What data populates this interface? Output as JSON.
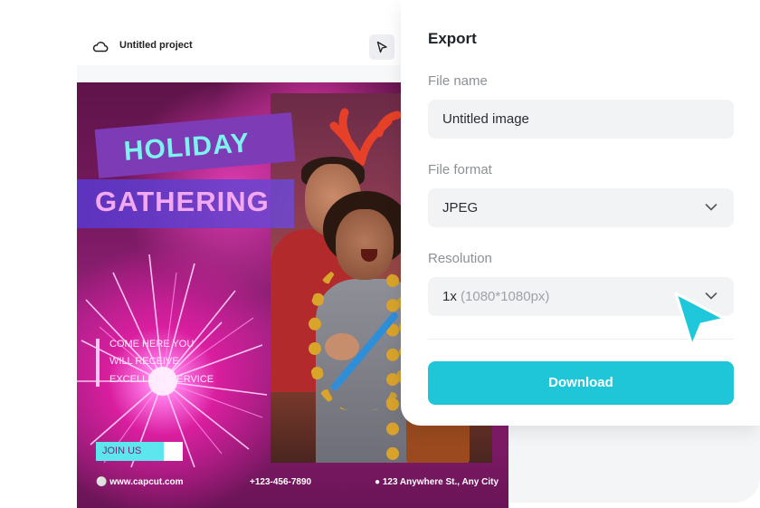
{
  "editor": {
    "project_name": "Untitled project",
    "icons": [
      "cloud-icon",
      "cursor-icon"
    ]
  },
  "poster": {
    "title_line1": "HOLIDAY",
    "title_line2": "GATHERING",
    "tagline": [
      "COME HERE YOU",
      "WILL RECEIVE",
      "EXCELLENT SERVICE"
    ],
    "cta": "JOIN US",
    "website": "www.capcut.com",
    "phone": "+123-456-7890",
    "address": "123 Anywhere St., Any City"
  },
  "export_panel": {
    "title": "Export",
    "file_name_label": "File name",
    "file_name_value": "Untitled image",
    "file_format_label": "File format",
    "file_format_value": "JPEG",
    "resolution_label": "Resolution",
    "resolution_value": "1x",
    "resolution_hint": "(1080*1080px)",
    "download_label": "Download"
  },
  "colors": {
    "accent": "#1fc6d7",
    "pointer": "#1ec8da",
    "poster_magenta": "#9c2381",
    "title_cyan": "#7ef2ee",
    "title_pink": "#f3a9f0"
  }
}
